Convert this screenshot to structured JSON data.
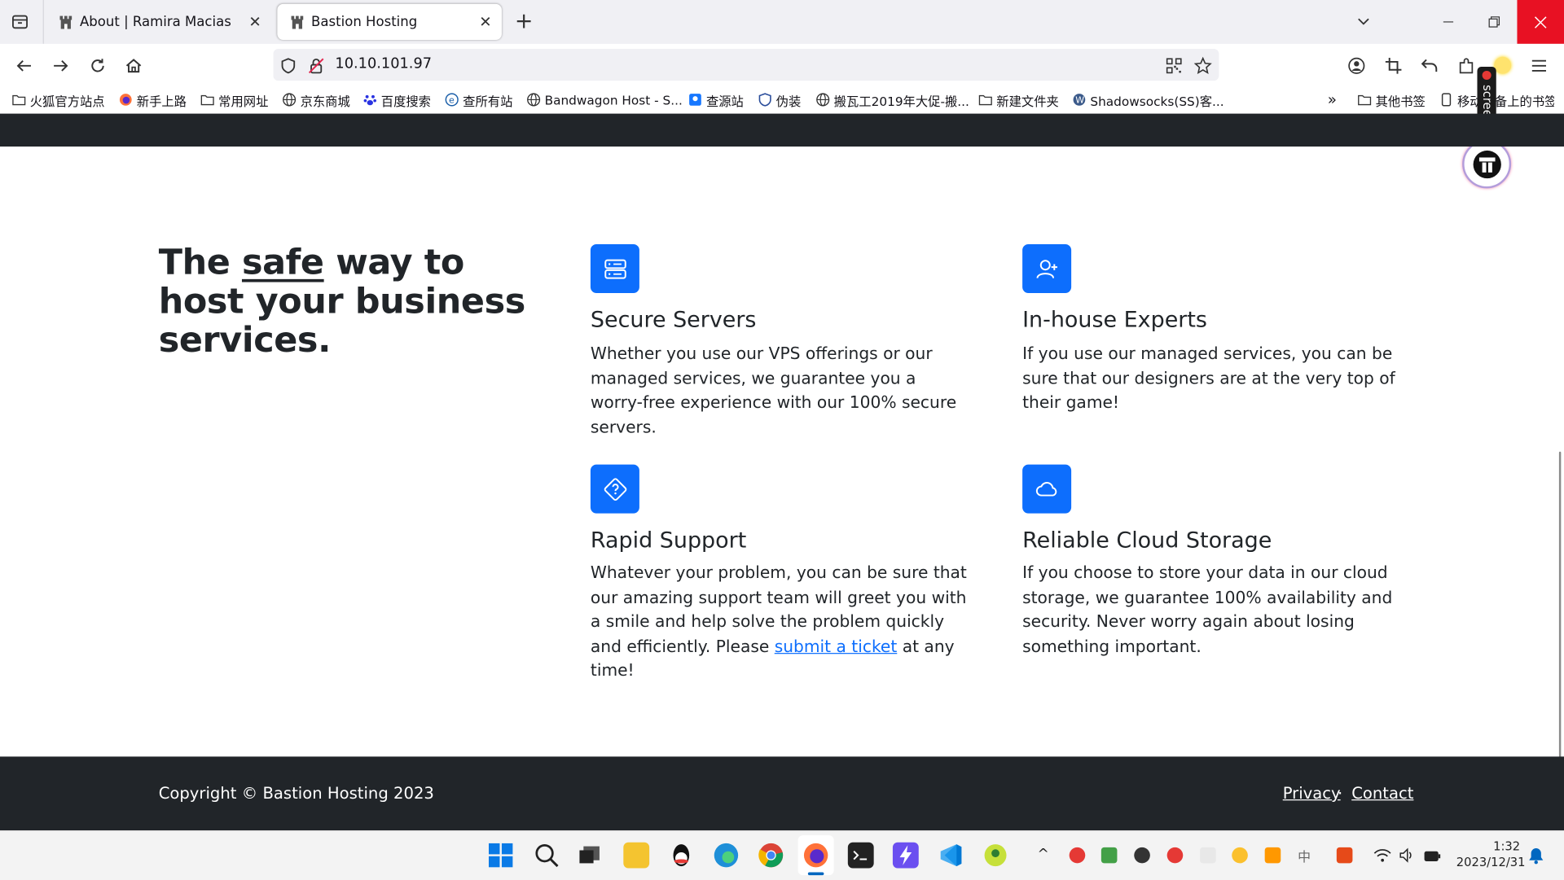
{
  "browser": {
    "tabs": [
      {
        "title": "About | Ramira Macias",
        "active": false
      },
      {
        "title": "Bastion Hosting",
        "active": true
      }
    ],
    "new_tab_label": "+",
    "address": "10.10.101.97",
    "bookmarks": [
      "火狐官方站点",
      "新手上路",
      "常用网址",
      "京东商城",
      "百度搜索",
      "查所有站",
      "Bandwagon Host - S...",
      "查源站",
      "伪装",
      "搬瓦工2019年大促-搬...",
      "新建文件夹",
      "Shadowsocks(SS)客..."
    ],
    "bookmarks_overflow": "»",
    "other_bookmarks": "其他书签",
    "mobile_bookmarks": "移动设备上的书签",
    "screenrec_label": "screenrec"
  },
  "page": {
    "hero": {
      "before": "The ",
      "emph": "safe",
      "after": " way to host your business services."
    },
    "features": [
      {
        "icon": "server-icon",
        "title": "Secure Servers",
        "desc": "Whether you use our VPS offerings or our managed services, we guarantee you a worry-free experience with our 100% secure servers."
      },
      {
        "icon": "person-add-icon",
        "title": "In-house Experts",
        "desc": "If you use our managed services, you can be sure that our designers are at the very top of their game!"
      },
      {
        "icon": "question-diamond-icon",
        "title": "Rapid Support",
        "desc_before": "Whatever your problem, you can be sure that our amazing support team will greet you with a smile and help solve the problem quickly and efficiently. Please ",
        "link": "submit a ticket",
        "desc_after": " at any time!"
      },
      {
        "icon": "cloud-icon",
        "title": "Reliable Cloud Storage",
        "desc": "If you choose to store your data in our cloud storage, we guarantee 100% availability and security. Never worry again about losing something important."
      }
    ],
    "footer": {
      "copyright": "Copyright © Bastion Hosting 2023",
      "links": [
        "Privacy",
        "Contact"
      ],
      "separator": "·"
    }
  },
  "taskbar": {
    "time": "1:32",
    "date": "2023/12/31",
    "ime": "中"
  },
  "colors": {
    "accent": "#0d6efd",
    "dark": "#212529",
    "tabstrip": "#f0f0f4"
  }
}
